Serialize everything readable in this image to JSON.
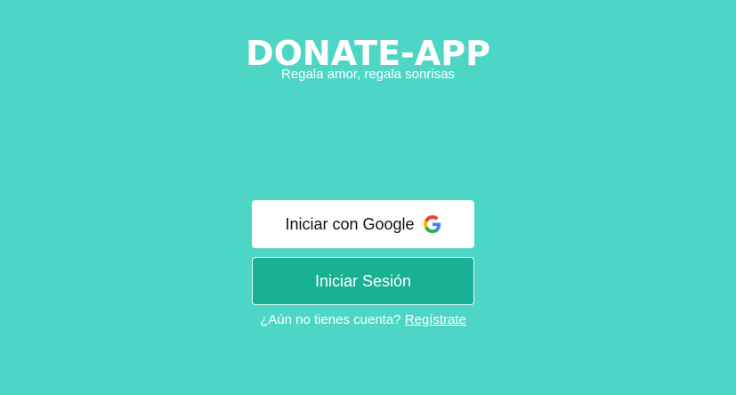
{
  "app": {
    "title": "DONATE-APP",
    "tagline": "Regala amor, regala sonrisas"
  },
  "auth": {
    "google_label": "Iniciar con Google",
    "google_icon": "google-g-icon",
    "login_label": "Iniciar Sesión",
    "signup_prompt": "¿Aún no tienes cuenta?",
    "signup_link": "Regístrate"
  },
  "colors": {
    "background": "#4dd6c6",
    "primary_button": "#18b194",
    "text_light": "#ffffff"
  }
}
